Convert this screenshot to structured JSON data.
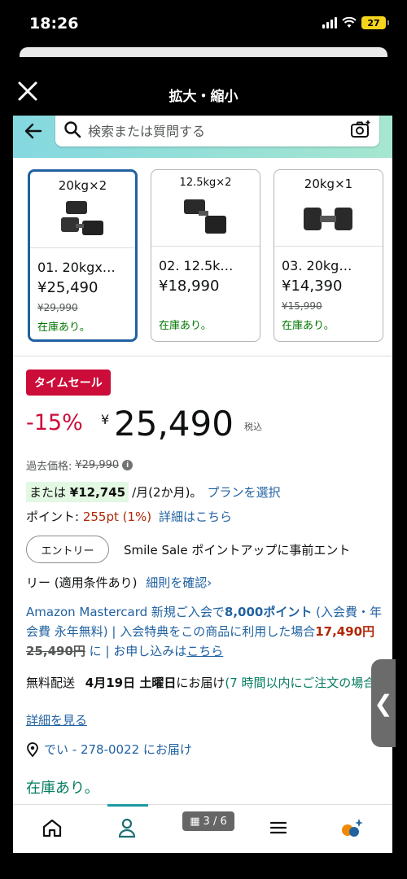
{
  "status": {
    "time": "18:26",
    "battery": "27"
  },
  "zoom": {
    "title": "拡大・縮小"
  },
  "search": {
    "placeholder": "検索または質問する"
  },
  "variants": [
    {
      "caption": "20kg×2",
      "name": "01. 20kgx…",
      "price": "¥25,490",
      "list_price": "¥29,990",
      "stock": "在庫あり。"
    },
    {
      "caption": "12.5kg×2",
      "name": "02. 12.5k…",
      "price": "¥18,990",
      "list_price": "",
      "stock": "在庫あり。"
    },
    {
      "caption": "20kg×1",
      "name": "03. 20kg…",
      "price": "¥14,390",
      "list_price": "¥15,990",
      "stock": "在庫あり。"
    }
  ],
  "deal": {
    "badge": "タイムセール",
    "discount": "-15%",
    "yen": "¥",
    "price": "25,490",
    "tax": "税込",
    "past_label": "過去価格:",
    "past_price": "¥29,990"
  },
  "installment": {
    "prefix": "または",
    "amount": "¥12,745",
    "suffix": "/月(2か月)。",
    "link": "プランを選択"
  },
  "points": {
    "label": "ポイント:",
    "value": "255pt (1%)",
    "link": "詳細はこちら"
  },
  "entry": {
    "button": "エントリー",
    "text": "Smile Sale ポイントアップに事前エント",
    "text2": "リー (適用条件あり)",
    "link": "細則を確認›"
  },
  "mastercard": {
    "line_a": "Amazon Mastercard 新規ご入会で",
    "points": "8,000ポイント",
    "line_b": "(入会費・年会費 永年無料) | 入会特典をこの商品に利用した場合",
    "new_price": "17,490円",
    "old_price": "25,490円",
    "line_c": "に | お申し込みは",
    "link": "こちら"
  },
  "delivery": {
    "free": "無料配送",
    "date": "4月19日 土曜日",
    "suffix": "にお届け",
    "window": "(7 時間以内にご注文の場合)",
    "details_link": "詳細を見る"
  },
  "location": {
    "text": "でい - 278-0022 にお届け"
  },
  "stock": {
    "text": "在庫あり。"
  },
  "side_tab": {
    "glyph": "❮"
  },
  "nav": {
    "page_indicator": "3 / 6"
  }
}
